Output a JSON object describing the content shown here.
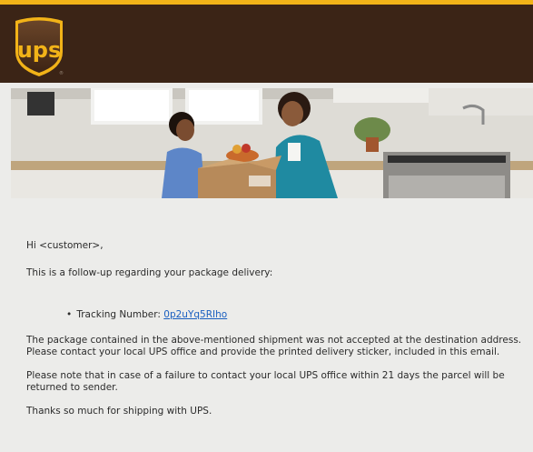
{
  "brand": {
    "logo_text": "ups",
    "brown": "#3b2416",
    "gold": "#f2b318"
  },
  "banner": {
    "alt": ""
  },
  "message": {
    "greeting": "Hi <customer>,",
    "intro": "This is a follow-up regarding your package delivery:",
    "tracking_label": "Tracking Number:",
    "tracking_number": "0p2uYq5RIho",
    "paragraph_1": "The package contained in the above-mentioned shipment was not accepted at the destination address. Please contact your local UPS office and provide the printed delivery sticker, included in this email.",
    "paragraph_2": "Please note that in case of a failure to contact your local UPS office within 21 days the parcel will be returned to sender.",
    "closing": "Thanks so much for shipping with UPS."
  }
}
